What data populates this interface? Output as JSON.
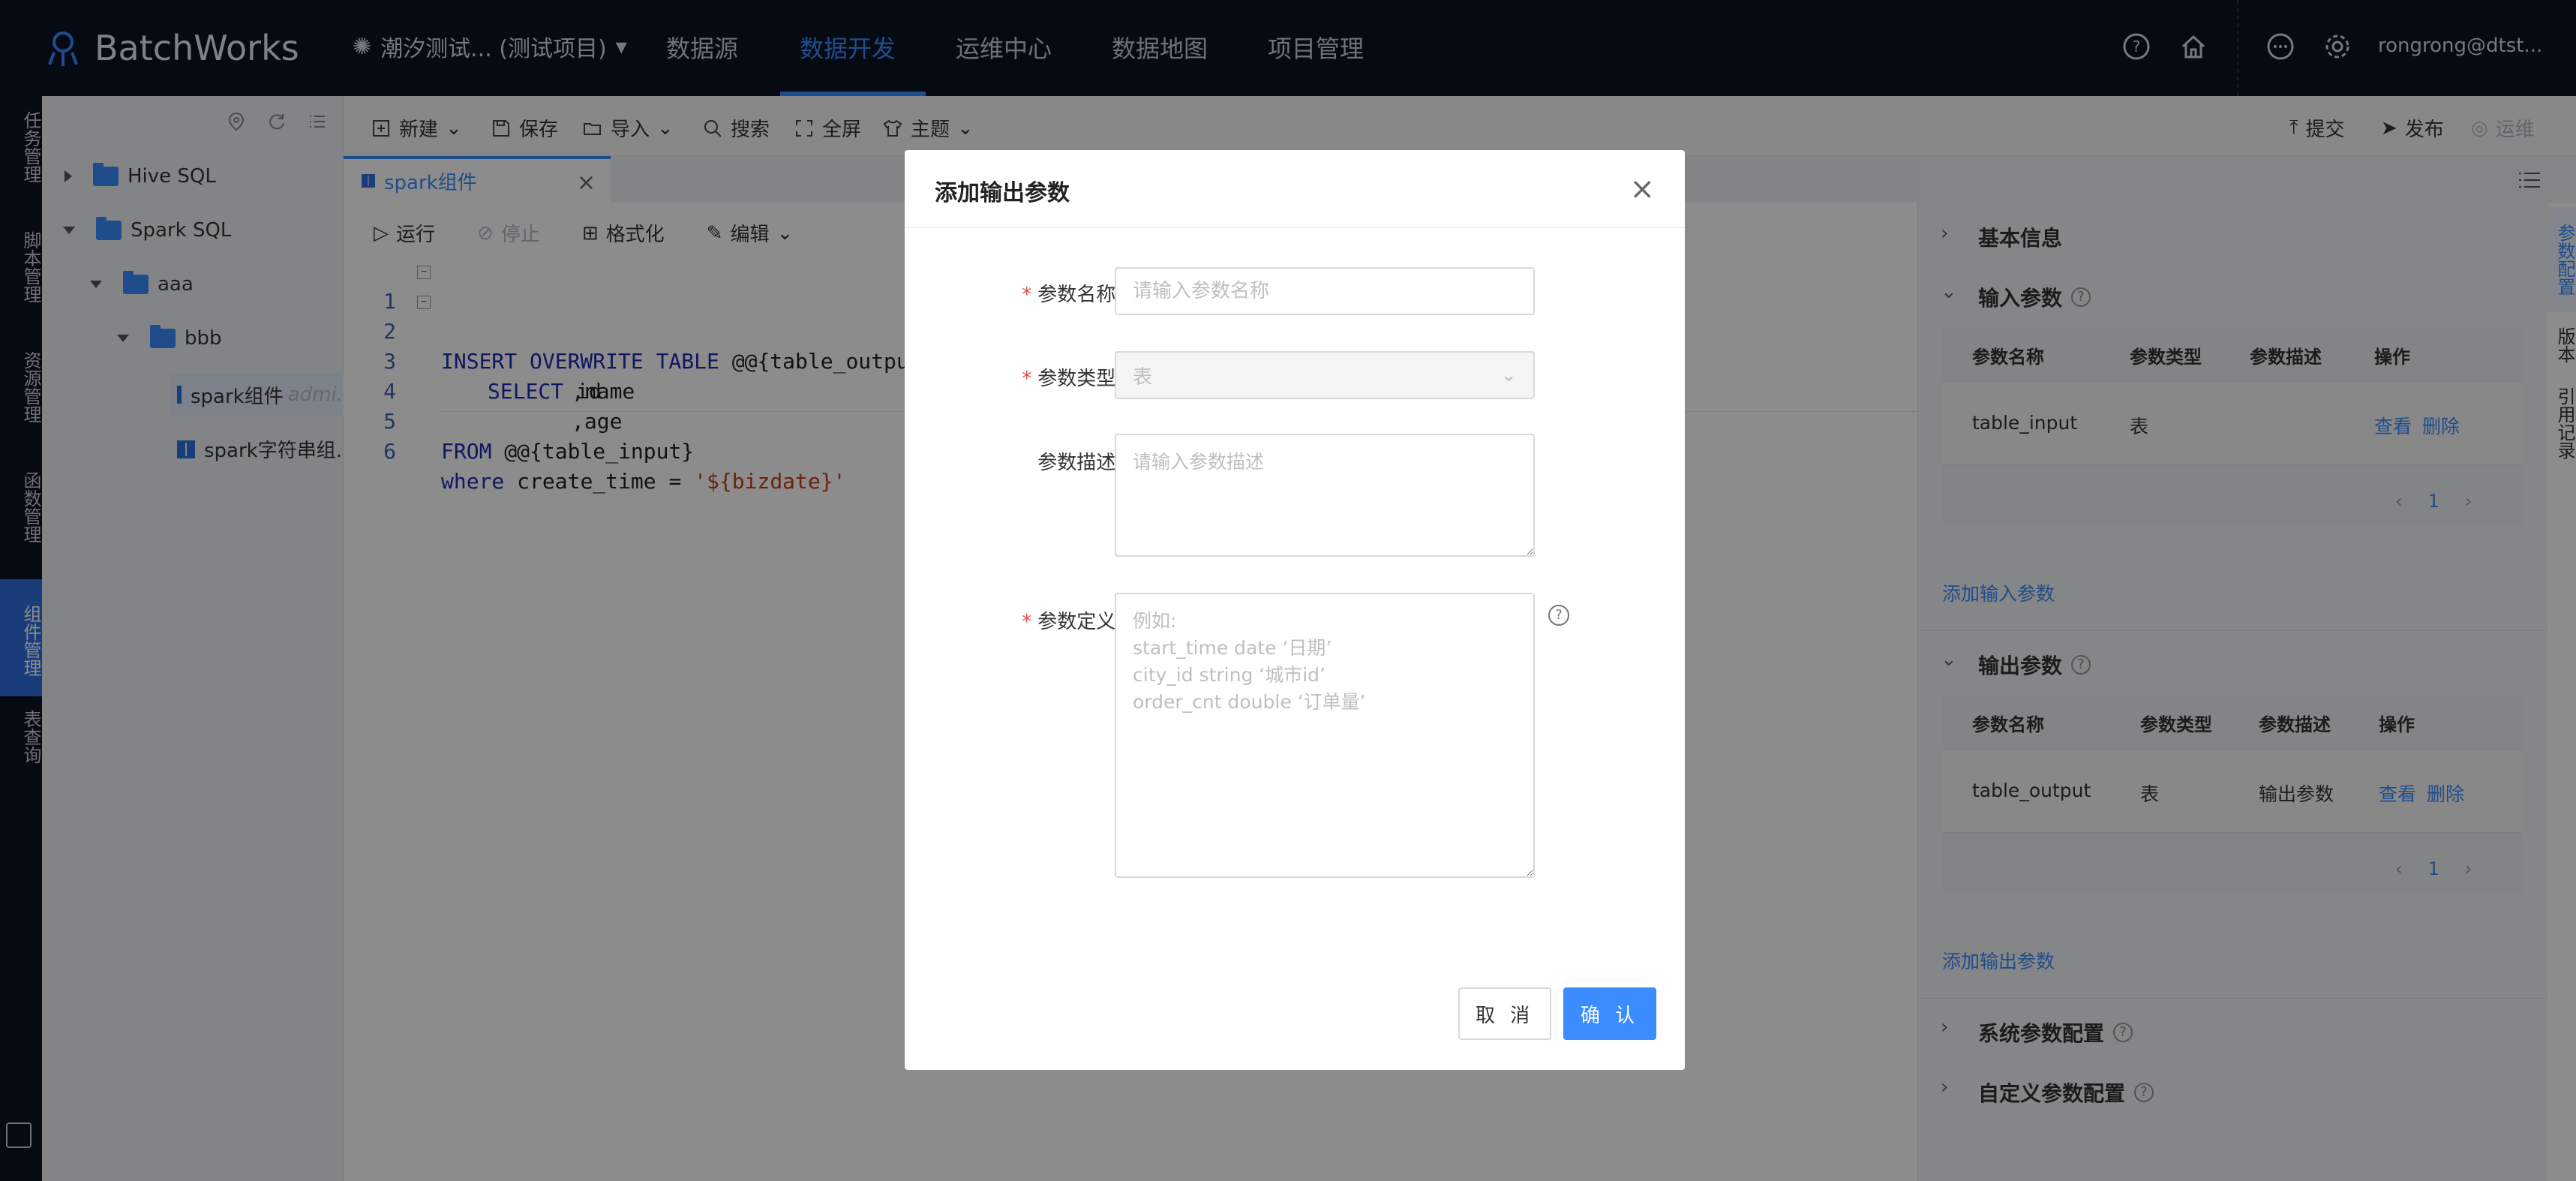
{
  "app": {
    "name": "BatchWorks",
    "project": "潮汐测试...  (测试项目)",
    "user": "rongrong@dtst..."
  },
  "nav": [
    "数据源",
    "数据开发",
    "运维中心",
    "数据地图",
    "项目管理"
  ],
  "rail": [
    "任务管理",
    "脚本管理",
    "资源管理",
    "函数管理",
    "组件管理",
    "表查询"
  ],
  "tree": {
    "nodes": [
      "Hive SQL",
      "Spark SQL",
      "aaa",
      "bbb",
      "spark组件",
      "spark字符串组..."
    ],
    "owner_hint": "admi..."
  },
  "toolbar": {
    "new": "新建",
    "save": "保存",
    "import": "导入",
    "search": "搜索",
    "fullscreen": "全屏",
    "theme": "主题",
    "submit": "提交",
    "publish": "发布",
    "ops": "运维"
  },
  "tab": {
    "label": "spark组件"
  },
  "editor_tools": {
    "run": "运行",
    "stop": "停止",
    "format": "格式化",
    "edit": "编辑"
  },
  "code": {
    "line_numbers": [
      "1",
      "2",
      "3",
      "4",
      "5",
      "6"
    ],
    "l1_kw": "INSERT OVERWRITE TABLE",
    "l1_rest": " @@{table_output}",
    "l2_kw": "SELECT",
    "l2_rest": " id",
    "l3": ",name",
    "l4": ",age",
    "l5_kw": "FROM",
    "l5_rest": " @@{table_input}",
    "l6_kw": "where",
    "l6_rest": " create_time = ",
    "l6_str": "'${bizdate}'"
  },
  "right_panel": {
    "basic": "基本信息",
    "input_title": "输入参数",
    "output_title": "输出参数",
    "system_title": "系统参数配置",
    "custom_title": "自定义参数配置",
    "headers": [
      "参数名称",
      "参数类型",
      "参数描述",
      "操作"
    ],
    "input_row": {
      "name": "table_input",
      "type": "表",
      "desc": "",
      "view": "查看",
      "delete": "删除"
    },
    "output_row": {
      "name": "table_output",
      "type": "表",
      "desc": "输出参数",
      "view": "查看",
      "delete": "删除"
    },
    "page": "1",
    "add_input": "添加输入参数",
    "add_output": "添加输出参数"
  },
  "vtabs": [
    "参数配置",
    "版本",
    "引用记录"
  ],
  "modal": {
    "title": "添加输出参数",
    "name_label": "参数名称:",
    "name_placeholder": "请输入参数名称",
    "type_label": "参数类型:",
    "type_value": "表",
    "desc_label": "参数描述:",
    "desc_placeholder": "请输入参数描述",
    "def_label": "参数定义:",
    "def_placeholder": "例如:\nstart_time date ‘日期’\ncity_id string ‘城市id’\norder_cnt double ‘订单量’",
    "cancel": "取 消",
    "ok": "确 认"
  }
}
